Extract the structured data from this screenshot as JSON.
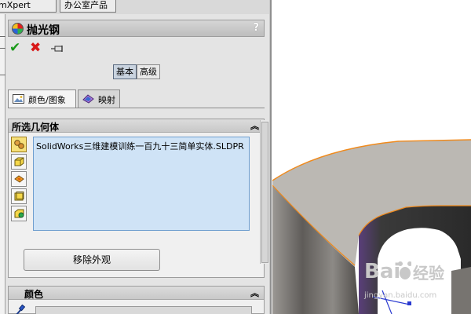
{
  "top_tabs": {
    "tab1": "mXpert",
    "tab2": "办公室产品"
  },
  "panel": {
    "title": "抛光钢",
    "help": "?",
    "mode": {
      "basic": "基本",
      "advanced": "高级"
    },
    "tabs": {
      "color_image": "颜色/图象",
      "mapping": "映射"
    }
  },
  "geometry_group": {
    "title": "所选几何体",
    "selected_items": [
      "SolidWorks三维建模训练一百九十三简单实体.SLDPR"
    ],
    "remove_button": "移除外观"
  },
  "color_group": {
    "title": "颜色"
  },
  "watermark": {
    "brand": "经验",
    "url": "jingyan.baidu.com"
  },
  "colors": {
    "panel_bg": "#e4e4e4",
    "list_bg": "#cfe3f6",
    "model_face": "#bbb8b3",
    "edge_highlight": "#f08a1c"
  }
}
